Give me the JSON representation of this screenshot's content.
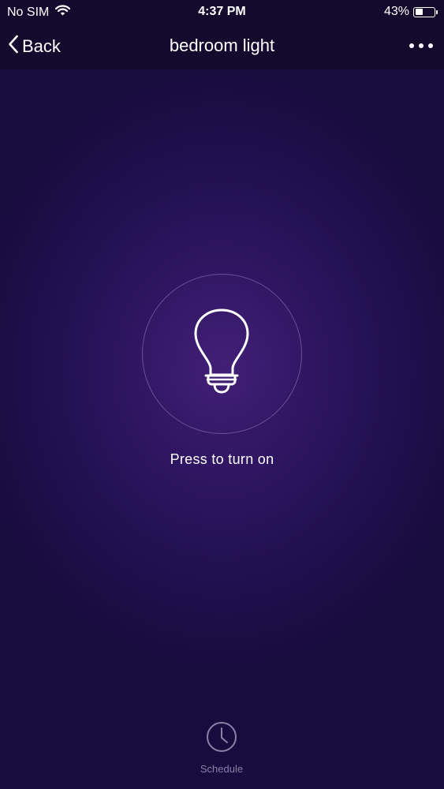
{
  "status_bar": {
    "carrier": "No SIM",
    "time": "4:37 PM",
    "battery_percent": "43%",
    "battery_level": 0.43,
    "wifi_icon": "wifi-icon",
    "battery_icon": "battery-icon"
  },
  "nav": {
    "back_label": "Back",
    "back_icon": "chevron-left-icon",
    "title": "bedroom light",
    "more_icon": "more-horizontal-icon"
  },
  "power": {
    "icon": "light-bulb-icon",
    "hint": "Press to turn on",
    "state": "off"
  },
  "bottom_bar": {
    "schedule_label": "Schedule",
    "schedule_icon": "clock-icon"
  },
  "colors": {
    "background": "#221051",
    "bar_background": "#130a2e",
    "ring": "#7a68a8",
    "muted_text": "#8a80a8"
  }
}
